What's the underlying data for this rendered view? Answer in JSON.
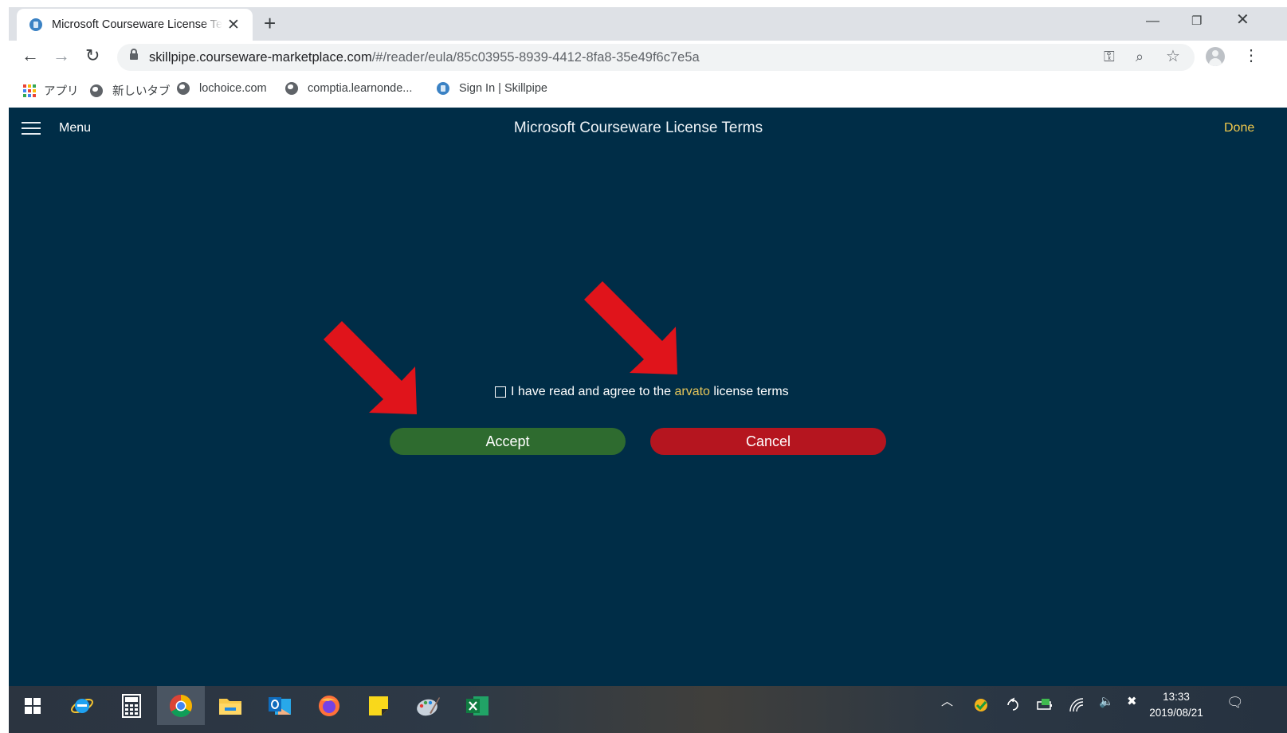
{
  "browser": {
    "tab": {
      "title": "Microsoft Courseware License Terms",
      "close_glyph": "✕"
    },
    "new_tab_glyph": "+",
    "window_controls": {
      "minimize": "—",
      "restore": "❐",
      "close": "✕"
    },
    "nav": {
      "back": "←",
      "forward": "→",
      "reload": "↻"
    },
    "url": {
      "host": "skillpipe.courseware-marketplace.com",
      "path": "/#/reader/eula/85c03955-8939-4412-8fa8-35e49f6c7e5a"
    },
    "omnibox_icons": [
      "key-icon",
      "zoom-icon",
      "star-icon"
    ],
    "omnibox_glyphs": {
      "key": "⚿",
      "zoom": "⌕",
      "star": "☆"
    },
    "menu_glyph": "⋮"
  },
  "bookmarks": [
    {
      "label": "アプリ",
      "icon": "apps-grid-icon"
    },
    {
      "label": "新しいタブ",
      "icon": "globe-icon"
    },
    {
      "label": "lochoice.com",
      "icon": "globe-icon"
    },
    {
      "label": "comptia.learnonde...",
      "icon": "globe-icon"
    },
    {
      "label": "Sign In | Skillpipe",
      "icon": "skillpipe-icon"
    }
  ],
  "apps_grid_colors": [
    "#ea4335",
    "#fbbc04",
    "#34a853",
    "#4285f4",
    "#ea4335",
    "#fbbc04",
    "#34a853",
    "#4285f4",
    "#ea4335"
  ],
  "page": {
    "menu_label": "Menu",
    "title": "Microsoft Courseware License Terms",
    "done_label": "Done",
    "agree": {
      "prefix": "I have read and agree to the ",
      "link": "arvato",
      "suffix": " license terms",
      "checked": false
    },
    "accept_label": "Accept",
    "cancel_label": "Cancel"
  },
  "colors": {
    "page_bg": "#002d47",
    "accept": "#2e6b2f",
    "cancel": "#b5151f",
    "link": "#e5c55a",
    "done": "#f2c94c",
    "annotation_arrow": "#e0141b"
  },
  "taskbar": {
    "apps": [
      "windows-start-icon",
      "internet-explorer-icon",
      "calculator-icon",
      "chrome-icon",
      "file-explorer-icon",
      "outlook-icon",
      "firefox-icon",
      "sticky-notes-icon",
      "paint-icon",
      "excel-icon"
    ],
    "active_app": "chrome-icon",
    "tray_glyphs": {
      "chevron": "︿",
      "volume": "🔈",
      "close_circle": "✖",
      "notifications": "🗨"
    },
    "time": "13:33",
    "date": "2019/08/21"
  }
}
